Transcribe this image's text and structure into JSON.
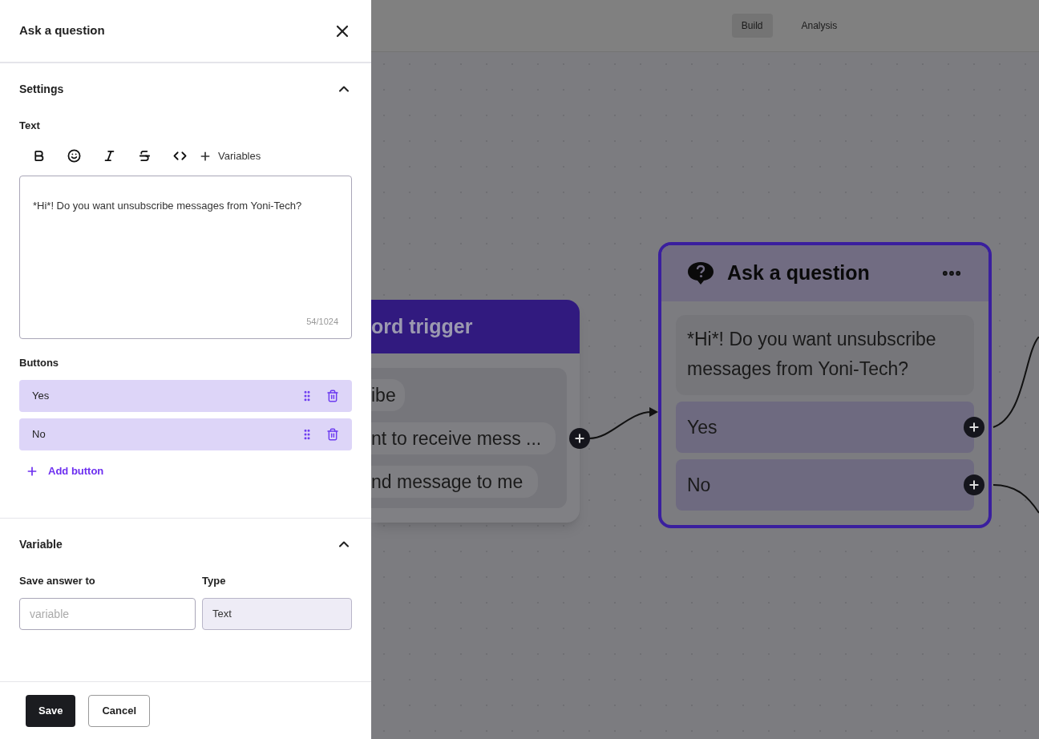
{
  "panel": {
    "title": "Ask a question",
    "settings": {
      "title": "Settings",
      "expanded": true,
      "text_label": "Text",
      "variables_label": "Variables",
      "text_value": "*Hi*! Do you want unsubscribe messages from Yoni-Tech?",
      "counter": "54/1024",
      "buttons_label": "Buttons",
      "buttons": [
        {
          "label": "Yes"
        },
        {
          "label": "No"
        }
      ],
      "add_button": "Add button"
    },
    "variable": {
      "title": "Variable",
      "expanded": true,
      "save_label": "Save answer to",
      "save_placeholder": "variable",
      "type_label": "Type",
      "type_value": "Text"
    },
    "footer": {
      "save": "Save",
      "cancel": "Cancel"
    }
  },
  "canvas": {
    "tabs": [
      {
        "label": "Build",
        "selected": true
      },
      {
        "label": "Analysis",
        "selected": false
      }
    ],
    "trigger_node": {
      "title": "ord trigger",
      "keywords": [
        "ibe",
        "nt to receive mess ...",
        "nd message to me"
      ]
    },
    "question_node": {
      "title": "Ask a question",
      "selected": true,
      "text": "*Hi*! Do you want unsubscribe messages from Yoni-Tech?",
      "buttons": [
        "Yes",
        "No"
      ]
    }
  }
}
